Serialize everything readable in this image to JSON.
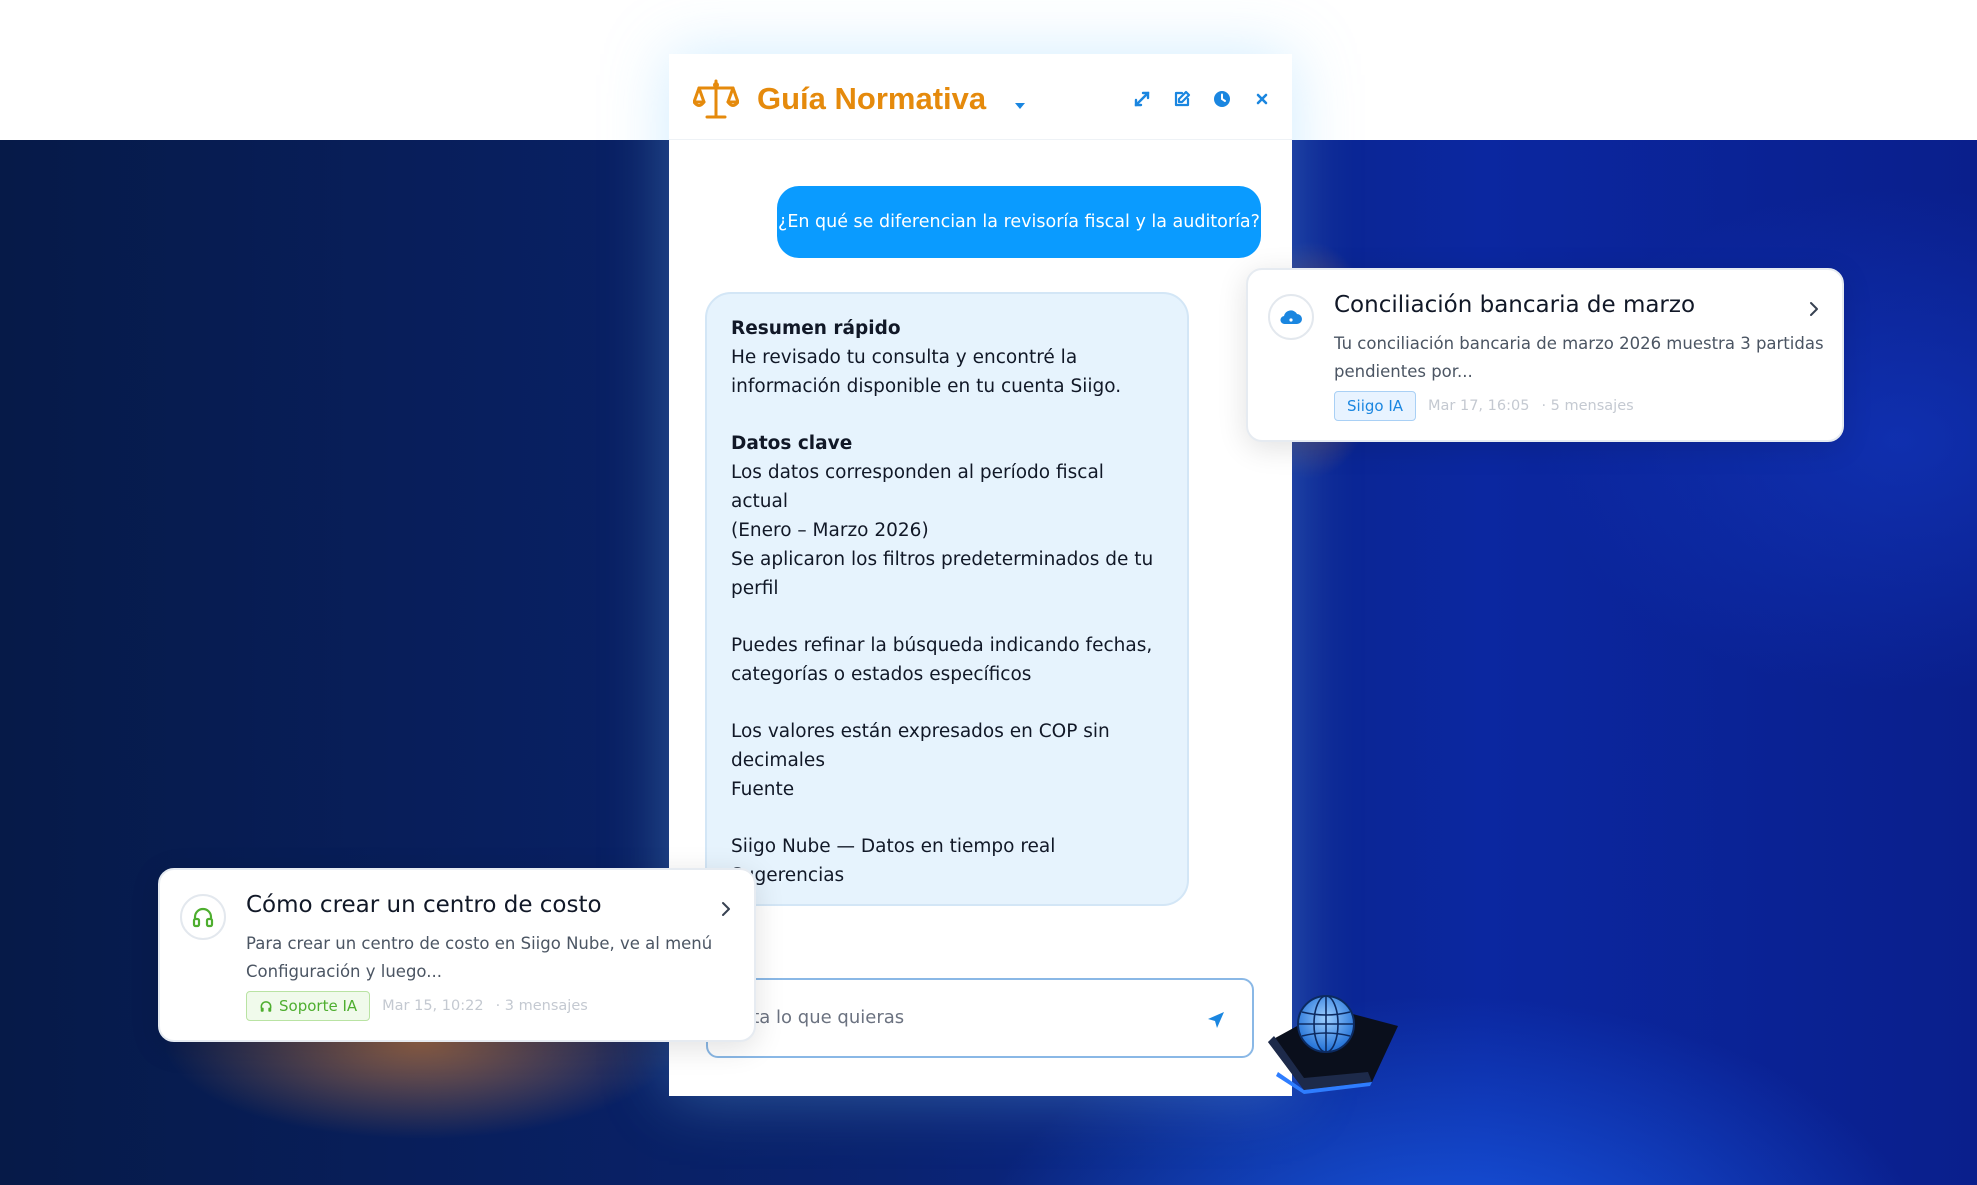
{
  "chat": {
    "title": "Guía Normativa",
    "header_icons": [
      "scale-icon",
      "caret-down-icon",
      "expand-icon",
      "edit-icon",
      "clock-icon",
      "close-icon"
    ],
    "user_message": "¿En qué se diferencian la revisoría fiscal y la auditoría?",
    "bot_lines": [
      {
        "text": "Resumen rápido",
        "bold": true
      },
      {
        "text": "He revisado tu consulta y encontré la"
      },
      {
        "text": "información disponible en tu cuenta Siigo."
      },
      {
        "text": "Datos clave",
        "bold": true
      },
      {
        "text": "Los datos corresponden al período fiscal actual"
      },
      {
        "text": "(Enero – Marzo 2026)"
      },
      {
        "text": "Se aplicaron los filtros predeterminados de tu"
      },
      {
        "text": "perfil"
      },
      {
        "text": "Puedes refinar la búsqueda indicando fechas,"
      },
      {
        "text": "categorías o estados específicos"
      },
      {
        "text": "Los valores están expresados en COP sin"
      },
      {
        "text": "decimales"
      },
      {
        "text": "Fuente"
      },
      {
        "text": "Siigo Nube — Datos en tiempo real"
      },
      {
        "text": "Sugerencias"
      }
    ],
    "input_placeholder": "gunta lo que quieras"
  },
  "cards": [
    {
      "title": "Conciliación bancaria de marzo",
      "description": "Tu conciliación bancaria de marzo 2026 muestra 3 partidas pendientes por...",
      "tag": "Siigo IA",
      "date": "Mar 17, 16:05",
      "messages": "· 5 mensajes",
      "icon": "cloud-icon"
    },
    {
      "title": "Cómo crear un centro de costo",
      "description": "Para crear un centro de costo en Siigo Nube, ve al menú Configuración y luego...",
      "tag": "Soporte IA",
      "date": "Mar 15, 10:22",
      "messages": "· 3 mensajes",
      "icon": "headphones-icon"
    }
  ],
  "colors": {
    "title_orange": "#e58a0c",
    "user_bubble": "#0a9bff",
    "bot_bubble": "#e6f3fd",
    "header_icon_blue": "#1a86e0",
    "background_dark": "#0a2370"
  }
}
